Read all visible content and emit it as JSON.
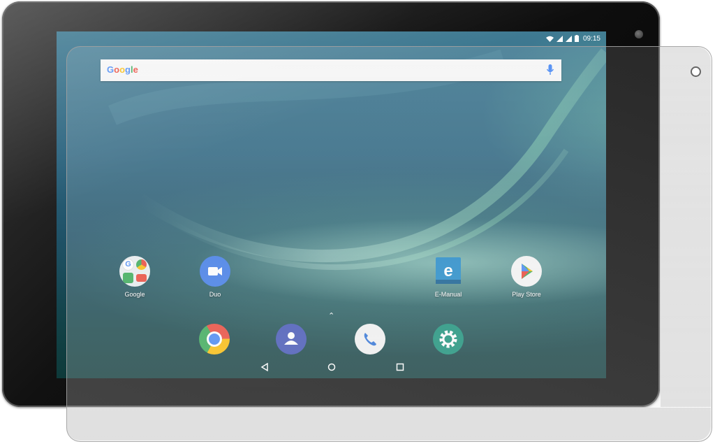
{
  "status_bar": {
    "time": "09:15",
    "icons": [
      "wifi-icon",
      "signal-icon",
      "signal-icon",
      "battery-icon"
    ]
  },
  "search": {
    "logo_text": "Google",
    "icon": "mic-icon"
  },
  "home_apps": [
    {
      "label": "Google",
      "icon": "google-folder-icon"
    },
    {
      "label": "Duo",
      "icon": "duo-icon"
    },
    {
      "label": "E-Manual",
      "icon": "e-manual-icon"
    },
    {
      "label": "Play Store",
      "icon": "play-store-icon"
    }
  ],
  "dock": [
    {
      "icon": "chrome-icon"
    },
    {
      "icon": "contacts-icon"
    },
    {
      "icon": "phone-icon"
    },
    {
      "icon": "settings-icon"
    }
  ],
  "nav_bar": [
    "back-icon",
    "home-icon",
    "recents-icon"
  ],
  "colors": {
    "google_blue": "#4285F4",
    "google_red": "#EA4335",
    "google_yellow": "#FBBC05",
    "google_green": "#34A853",
    "duo_blue": "#3b78e7",
    "contacts_blue": "#3f51b5",
    "settings_teal": "#148f77"
  }
}
